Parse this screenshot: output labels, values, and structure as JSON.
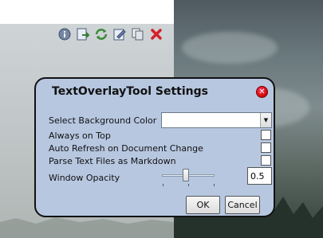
{
  "dialog": {
    "title": "TextOverlayTool Settings",
    "close_glyph": "✕",
    "fields": {
      "bg_color_label": "Select Background Color",
      "bg_color_value": "",
      "always_on_top_label": "Always on Top",
      "always_on_top_checked": false,
      "auto_refresh_label": "Auto Refresh on Document Change",
      "auto_refresh_checked": false,
      "parse_markdown_label": "Parse Text Files as Markdown",
      "parse_markdown_checked": false,
      "opacity_label": "Window Opacity",
      "opacity_value": "0.5"
    },
    "buttons": {
      "ok": "OK",
      "cancel": "Cancel"
    }
  },
  "toolbar": {
    "icons": [
      "info-icon",
      "export-icon",
      "refresh-icon",
      "edit-icon",
      "copy-icon",
      "close-icon"
    ]
  },
  "colors": {
    "dialog_bg": "#b7c7e0",
    "close_red": "#d11"
  }
}
